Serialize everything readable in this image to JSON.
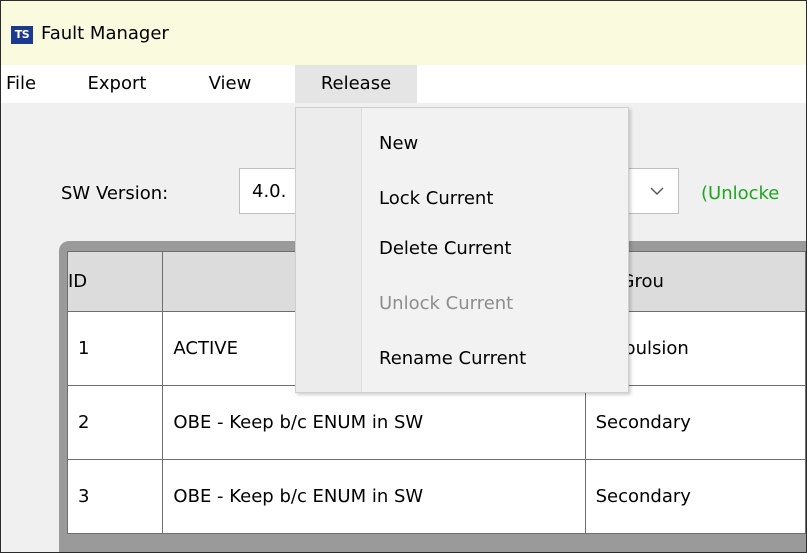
{
  "window": {
    "title": "Fault Manager",
    "icon": "TS"
  },
  "menubar": {
    "items": [
      {
        "label": "File"
      },
      {
        "label": "Export"
      },
      {
        "label": "View"
      },
      {
        "label": "Release"
      }
    ]
  },
  "release_menu": {
    "items": [
      {
        "label": "New",
        "enabled": true
      },
      {
        "label": "Lock Current",
        "enabled": true
      },
      {
        "label": "Delete Current",
        "enabled": true
      },
      {
        "label": "Unlock Current",
        "enabled": false
      },
      {
        "label": "Rename Current",
        "enabled": true
      }
    ]
  },
  "sw_version": {
    "label": "SW Version:",
    "value": "4.0.",
    "status": "(Unlocke"
  },
  "grid": {
    "columns": [
      "ID",
      "",
      "SW Grou"
    ],
    "rows": [
      {
        "id": "1",
        "name": "ACTIVE",
        "group": "Propulsion"
      },
      {
        "id": "2",
        "name": "OBE - Keep b/c ENUM in SW",
        "group": "Secondary"
      },
      {
        "id": "3",
        "name": "OBE - Keep b/c ENUM in SW",
        "group": "Secondary"
      }
    ]
  },
  "colors": {
    "title_bg": "#fafadf",
    "status_green": "#1fa51f",
    "icon_blue": "#1b3a8f"
  }
}
